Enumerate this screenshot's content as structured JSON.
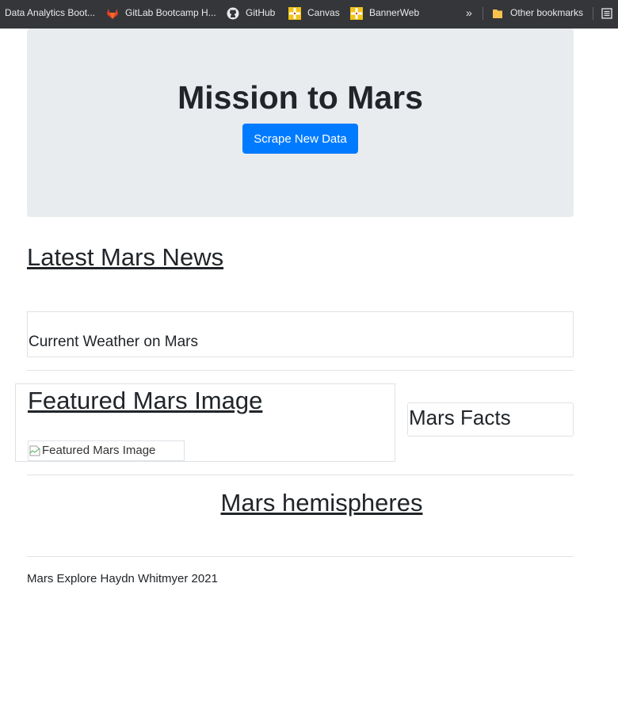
{
  "bookmarks_bar": {
    "items": [
      {
        "label": "Data Analytics Boot...",
        "icon": "none"
      },
      {
        "label": "GitLab Bootcamp H...",
        "icon": "gitlab-icon"
      },
      {
        "label": "GitHub",
        "icon": "github-icon"
      },
      {
        "label": "Canvas",
        "icon": "canvas-icon"
      },
      {
        "label": "BannerWeb",
        "icon": "bannerweb-icon"
      }
    ],
    "overflow_label": "»",
    "other_bookmarks_label": "Other bookmarks"
  },
  "jumbotron": {
    "title": "Mission to Mars",
    "scrape_button_label": "Scrape New Data"
  },
  "news": {
    "heading": "Latest Mars News"
  },
  "weather": {
    "heading": "Current Weather on Mars"
  },
  "featured_image": {
    "heading": "Featured Mars Image",
    "alt_text": "Featured Mars Image"
  },
  "facts": {
    "heading": "Mars Facts"
  },
  "hemispheres": {
    "heading": "Mars hemispheres"
  },
  "footer": {
    "text": "Mars Explore Haydn Whitmyer 2021"
  },
  "colors": {
    "bookmarks_bg": "#35363a",
    "jumbotron_bg": "#e9ecef",
    "button_primary": "#007bff",
    "text": "#212529"
  }
}
